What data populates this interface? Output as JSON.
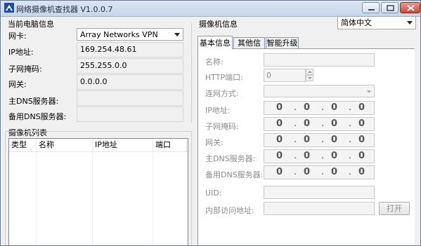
{
  "window": {
    "title": "网络摄像机查找器 V1.0.0.7"
  },
  "pc_info": {
    "section_title": "当前电脑信息",
    "nic_label": "网卡:",
    "nic_value": "Array Networks VPN Adapter",
    "ip_label": "IP地址:",
    "ip_value": "169.254.48.61",
    "mask_label": "子网掩码:",
    "mask_value": "255.255.0.0",
    "gateway_label": "网关:",
    "gateway_value": "0.0.0.0",
    "dns1_label": "主DNS服务器:",
    "dns1_value": "",
    "dns2_label": "备用DNS服务器:",
    "dns2_value": ""
  },
  "camera_list": {
    "section_title": "摄像机列表",
    "columns": [
      "类型",
      "名称",
      "IP地址",
      "端口"
    ]
  },
  "camera_info": {
    "section_title": "摄像机信息",
    "language": "简体中文",
    "tabs": [
      "基本信息",
      "其他信息",
      "智能升级"
    ],
    "name_label": "名称:",
    "name_value": "",
    "http_port_label": "HTTP端口:",
    "http_port_value": "0",
    "connect_label": "连网方式:",
    "connect_value": "",
    "ip_label": "IP地址:",
    "mask_label": "子网掩码:",
    "gateway_label": "网关:",
    "dns1_label": "主DNS服务器:",
    "dns2_label": "备用DNS服务器:",
    "ip_parts": [
      "0",
      "0",
      "0",
      "0"
    ],
    "uid_label": "UID:",
    "uid_value": "",
    "internal_label": "内部访问地址:",
    "internal_value": "",
    "open_button": "打开"
  }
}
